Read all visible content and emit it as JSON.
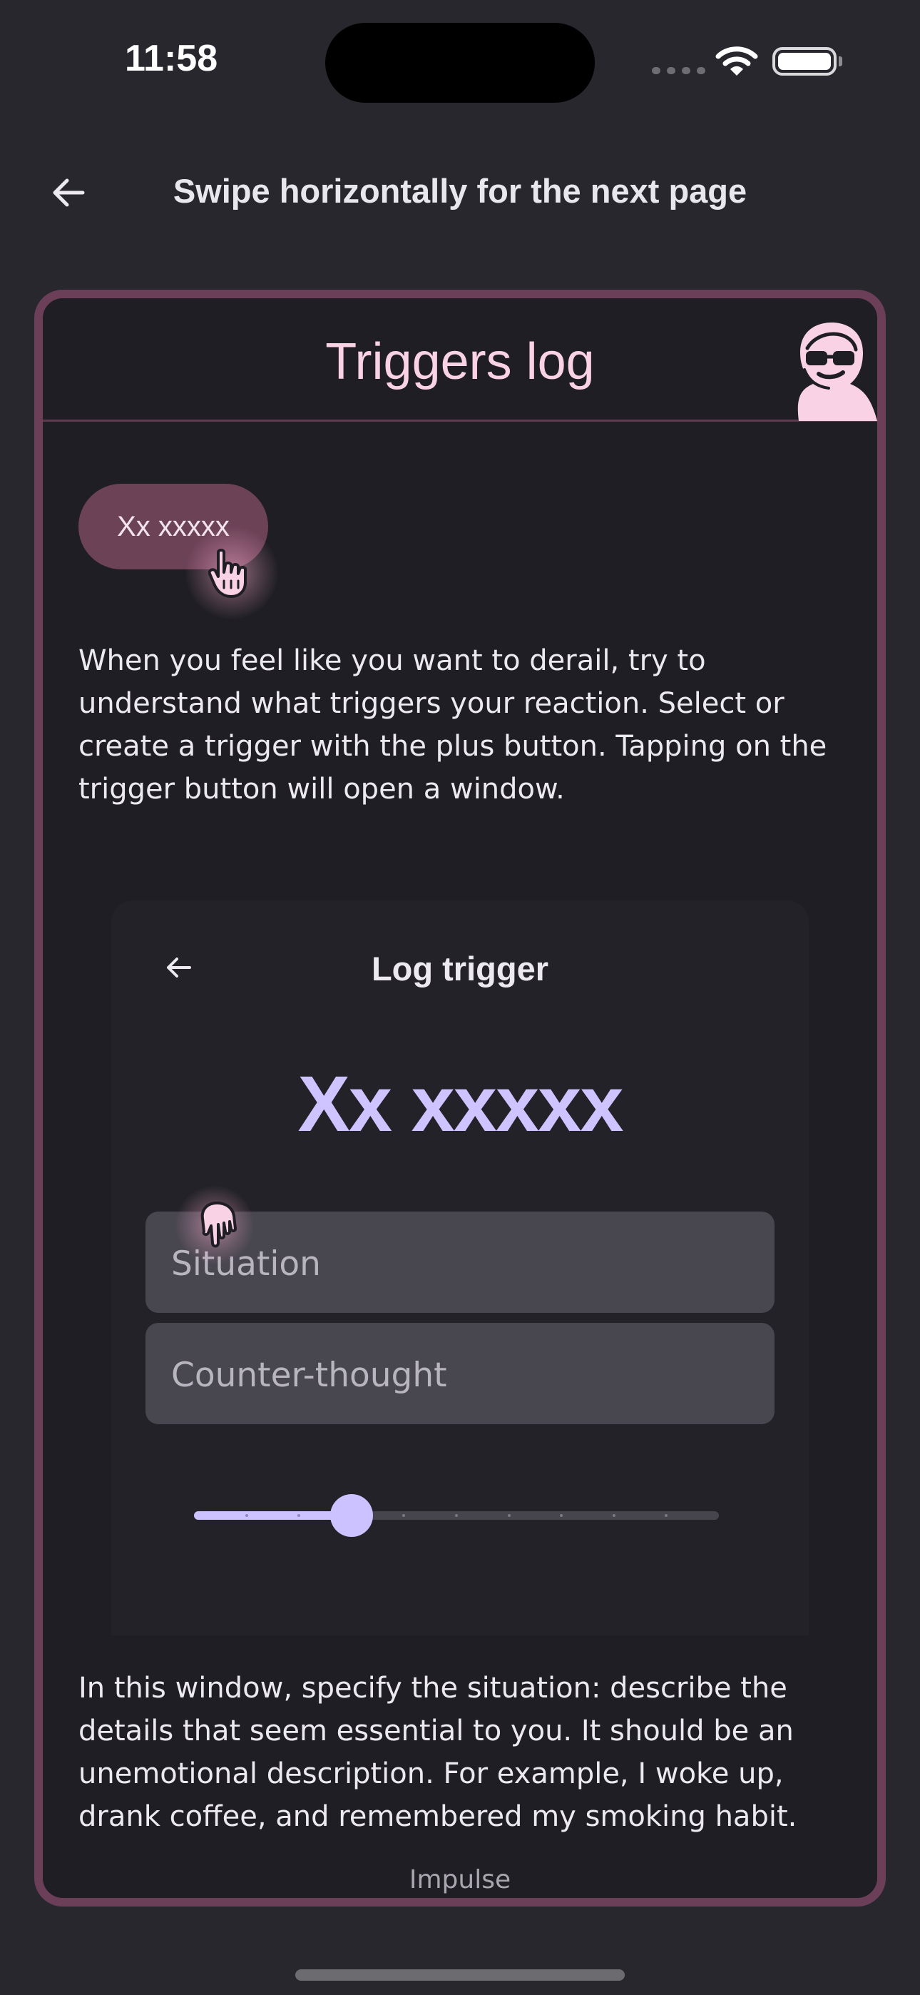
{
  "status_bar": {
    "time": "11:58"
  },
  "nav": {
    "title": "Swipe horizontally for the next page"
  },
  "card": {
    "title": "Triggers log",
    "chip_label": "Xx xxxxx",
    "paragraph_1": "When you feel like you want to derail, try to understand what triggers your reaction. Select or create a trigger with the plus button. Tapping on the trigger button will open a window.",
    "paragraph_2": "In this window, specify the situation: describe the details that seem essential to you. It should be an unemotional description. For example, I woke up, drank coffee, and remembered my smoking habit."
  },
  "dialog": {
    "title": "Log trigger",
    "trigger_name": "Xx xxxxx",
    "situation_placeholder": "Situation",
    "counter_thought_placeholder": "Counter-thought",
    "slider_label": "Impulse",
    "slider_value": 3,
    "slider_max": 10
  },
  "colors": {
    "background": "#28272e",
    "card_border": "#6b3f58",
    "card_title": "#f9d2e6",
    "accent": "#cbc2ff",
    "chip": "#6c4257"
  }
}
